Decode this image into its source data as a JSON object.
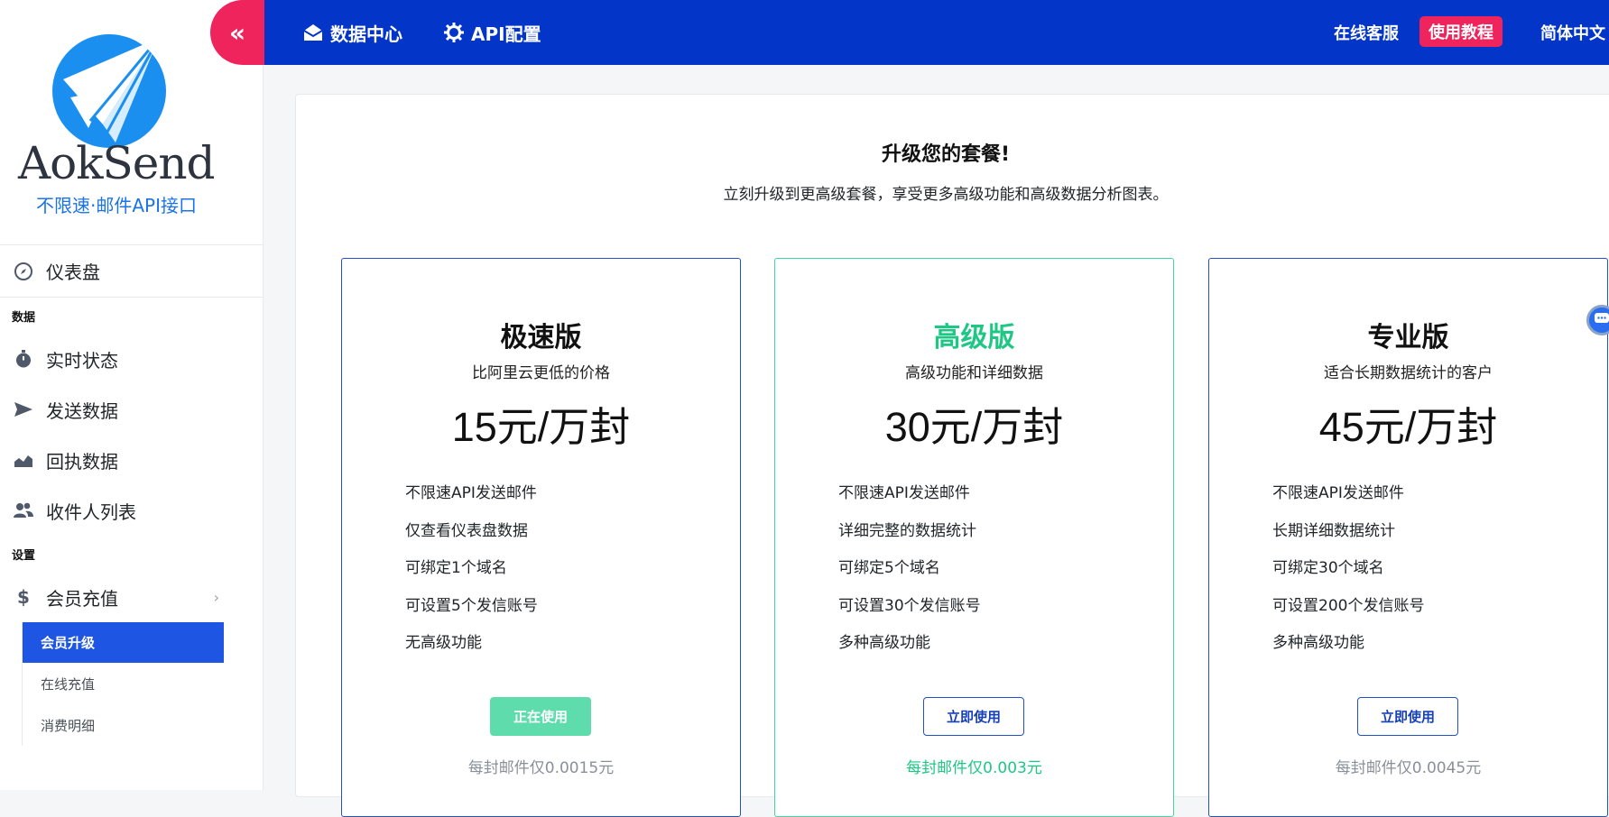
{
  "logo": {
    "brand": "AokSend",
    "tagline": "不限速·邮件API接口"
  },
  "sidebar": {
    "dashboard": {
      "label": "仪表盘",
      "icon": "compass-icon"
    },
    "section_data": "数据",
    "data_items": [
      {
        "label": "实时状态",
        "icon": "stopwatch-icon"
      },
      {
        "label": "发送数据",
        "icon": "send-icon"
      },
      {
        "label": "回执数据",
        "icon": "area-chart-icon"
      },
      {
        "label": "收件人列表",
        "icon": "users-icon"
      }
    ],
    "section_settings": "设置",
    "membership": {
      "label": "会员充值",
      "icon": "dollar-icon"
    },
    "sub_items": [
      {
        "label": "会员升级",
        "active": true
      },
      {
        "label": "在线充值",
        "active": false
      },
      {
        "label": "消费明细",
        "active": false
      }
    ]
  },
  "topbar": {
    "toggle_icon": "double-chevron-left-icon",
    "data_center": "数据中心",
    "api_config": "API配置",
    "support": "在线客服",
    "tutorial": "使用教程",
    "language": "简体中文",
    "accent": "#f0245c",
    "bar_color": "#0335c8"
  },
  "main": {
    "title": "升级您的套餐!",
    "subtitle": "立刻升级到更高级套餐，享受更多高级功能和高级数据分析图表。",
    "plans": [
      {
        "name": "极速版",
        "desc": "比阿里云更低的价格",
        "price": "15元/万封",
        "features": [
          "不限速API发送邮件",
          "仅查看仪表盘数据",
          "可绑定1个域名",
          "可设置5个发信账号",
          "无高级功能"
        ],
        "button": "正在使用",
        "note": "每封邮件仅0.0015元"
      },
      {
        "name": "高级版",
        "desc": "高级功能和详细数据",
        "price": "30元/万封",
        "features": [
          "不限速API发送邮件",
          "详细完整的数据统计",
          "可绑定5个域名",
          "可设置30个发信账号",
          "多种高级功能"
        ],
        "button": "立即使用",
        "note": "每封邮件仅0.003元"
      },
      {
        "name": "专业版",
        "desc": "适合长期数据统计的客户",
        "price": "45元/万封",
        "features": [
          "不限速API发送邮件",
          "长期详细数据统计",
          "可绑定30个域名",
          "可设置200个发信账号",
          "多种高级功能"
        ],
        "button": "立即使用",
        "note": "每封邮件仅0.0045元"
      }
    ]
  }
}
